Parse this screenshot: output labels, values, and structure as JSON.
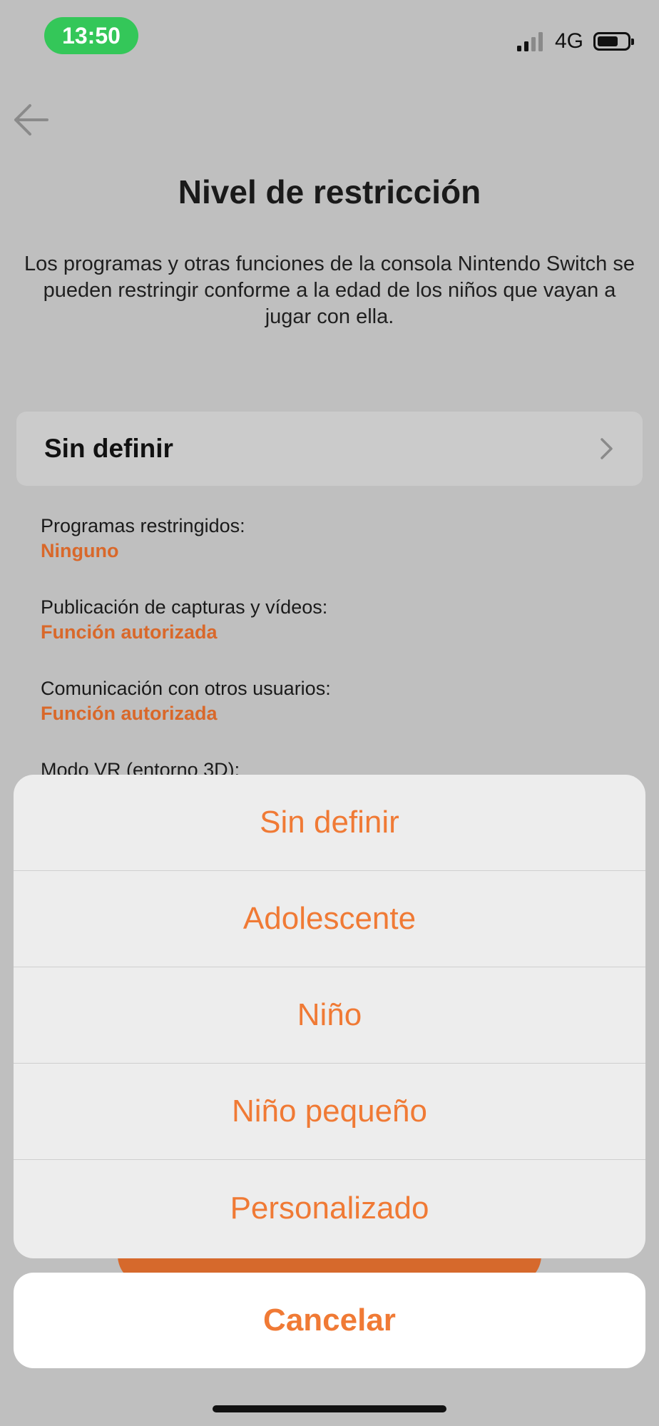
{
  "status_bar": {
    "time": "13:50",
    "network": "4G",
    "icons": [
      "signal-icon",
      "battery-icon"
    ]
  },
  "header": {
    "back_icon": "arrow-left-icon",
    "title": "Nivel de restricción",
    "description": "Los programas y otras funciones de la consola Nintendo Switch se pueden restringir conforme a la edad de los niños que vayan a jugar con ella."
  },
  "restriction_row": {
    "label": "Sin definir",
    "icon": "chevron-right-icon"
  },
  "settings": [
    {
      "label": "Programas restringidos:",
      "value": "Ninguno"
    },
    {
      "label": "Publicación de capturas y vídeos:",
      "value": "Función autorizada"
    },
    {
      "label": "Comunicación con otros usuarios:",
      "value": "Función autorizada"
    },
    {
      "label": "Modo VR (entorno 3D):",
      "value": ""
    }
  ],
  "action_sheet": {
    "options": [
      "Sin definir",
      "Adolescente",
      "Niño",
      "Niño pequeño",
      "Personalizado"
    ],
    "cancel_label": "Cancelar"
  },
  "colors": {
    "accent": "#f07a35",
    "value_text": "#d9682a",
    "dim_background": "#bfbfbf"
  }
}
